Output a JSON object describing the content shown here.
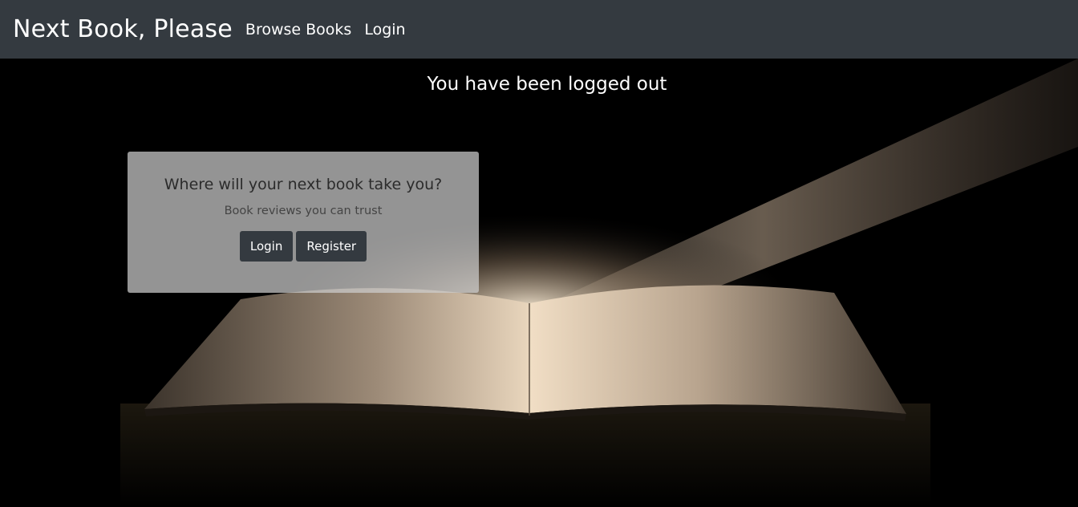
{
  "navbar": {
    "brand": "Next Book, Please",
    "links": [
      "Browse Books",
      "Login"
    ]
  },
  "flash": {
    "message": "You have been logged out"
  },
  "hero_card": {
    "title": "Where will your next book take you?",
    "subtitle": "Book reviews you can trust",
    "login_label": "Login",
    "register_label": "Register"
  },
  "colors": {
    "navbar_bg": "#343a40",
    "button_bg": "#343a40",
    "page_bg": "#000000"
  }
}
